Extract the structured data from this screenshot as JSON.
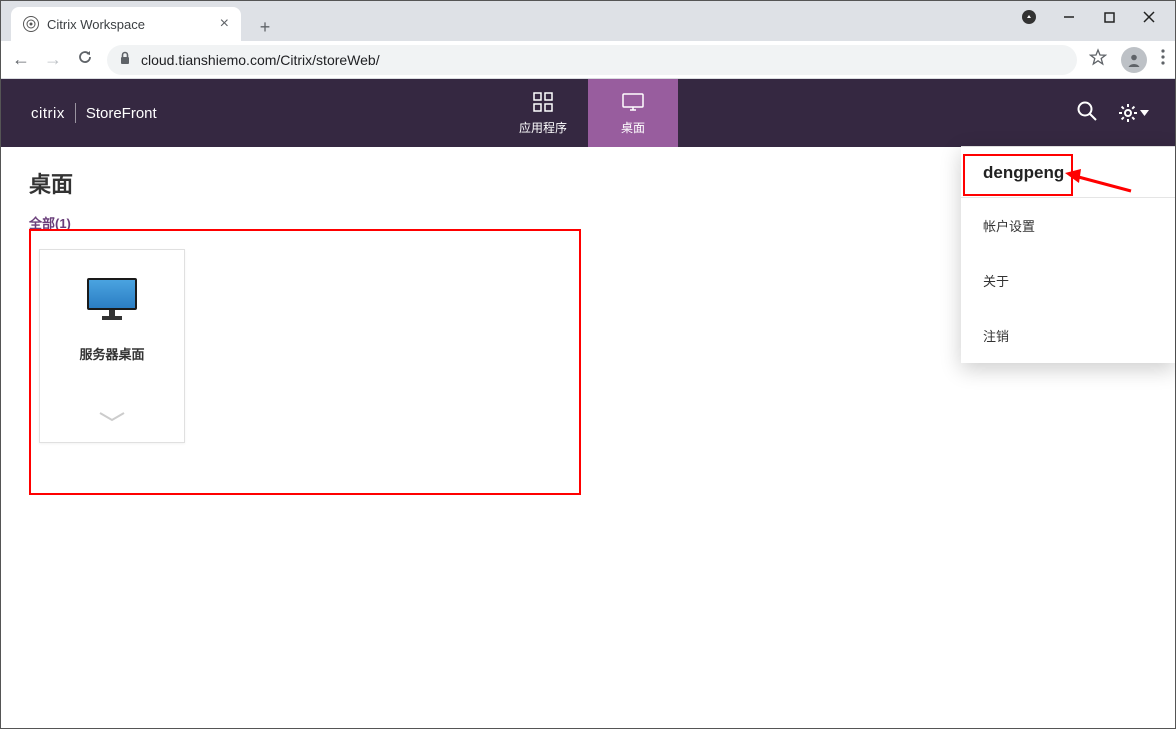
{
  "browser": {
    "tab_title": "Citrix Workspace",
    "url": "cloud.tianshiemo.com/Citrix/storeWeb/"
  },
  "header": {
    "brand_logo": "citrix",
    "brand_product": "StoreFront",
    "nav": {
      "apps": "应用程序",
      "desktops": "桌面"
    }
  },
  "page": {
    "title": "桌面",
    "filter_all": "全部(1)",
    "card_label": "服务器桌面"
  },
  "dropdown": {
    "username": "dengpeng",
    "account_settings": "帐户设置",
    "about": "关于",
    "logout": "注销"
  }
}
